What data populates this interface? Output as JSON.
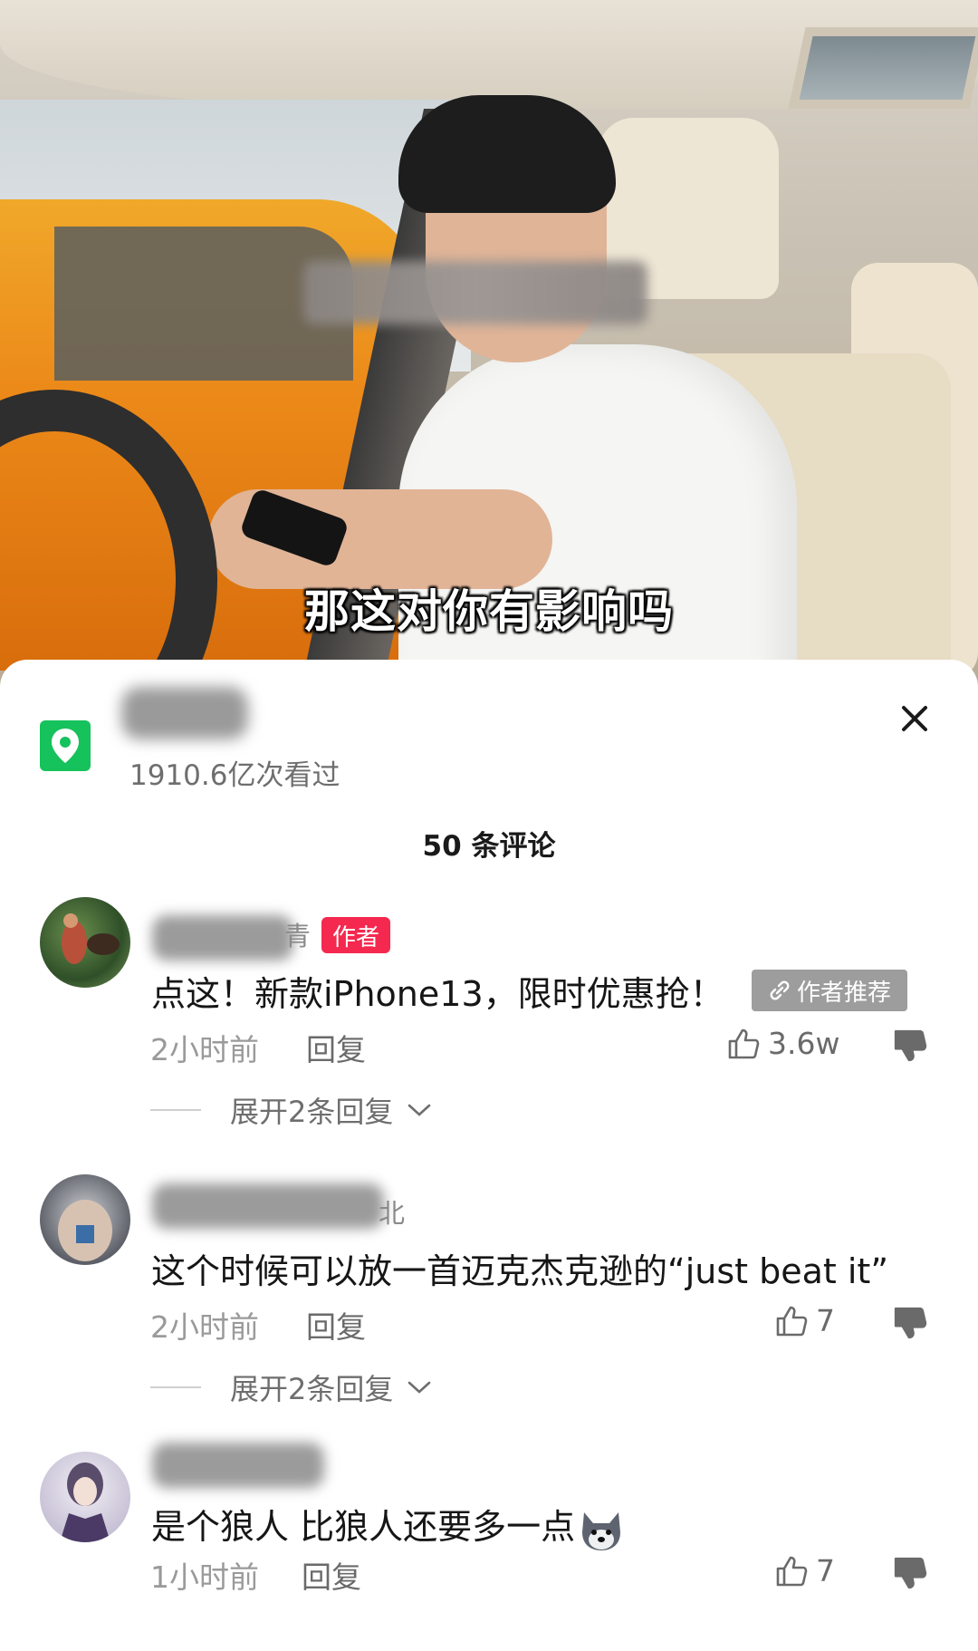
{
  "video": {
    "subtitle": "那这对你有影响吗"
  },
  "sheet": {
    "location_views": "1910.6亿次看过",
    "comment_count": "50 条评论",
    "close_icon": "close-icon",
    "location_icon": "location-pin-icon"
  },
  "comments": [
    {
      "name_tail": "青",
      "badge": "作者",
      "text": "点这！新款iPhone13，限时优惠抢！",
      "recommend_label": "作者推荐",
      "time": "2小时前",
      "reply": "回复",
      "likes": "3.6w",
      "expand": "展开2条回复"
    },
    {
      "name_tail": "北",
      "text": "这个时候可以放一首迈克杰克逊的“just beat it”",
      "time": "2小时前",
      "reply": "回复",
      "likes": "7",
      "expand": "展开2条回复"
    },
    {
      "text": "是个狼人  比狼人还要多一点",
      "time": "1小时前",
      "reply": "回复",
      "likes": "7"
    }
  ],
  "colors": {
    "author_badge": "#f5284f",
    "location_icon_bg": "#16c25b",
    "recommend_badge": "#9d9d9d"
  }
}
